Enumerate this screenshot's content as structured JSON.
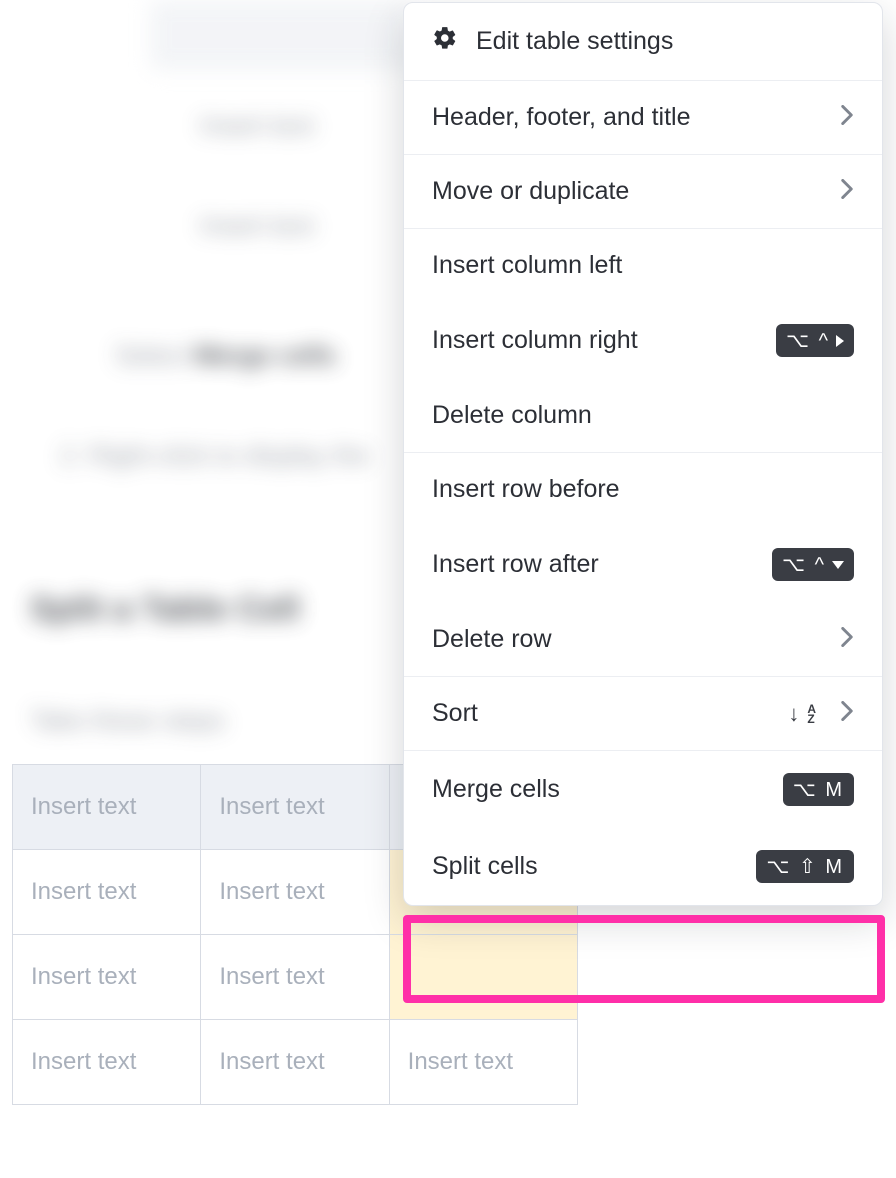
{
  "menu": {
    "edit_settings": "Edit table settings",
    "header_footer_title": "Header, footer, and title",
    "move_duplicate": "Move or duplicate",
    "insert_col_left": "Insert column left",
    "insert_col_right": "Insert column right",
    "insert_col_right_kbd": "⌥ ^",
    "delete_column": "Delete column",
    "insert_row_before": "Insert row before",
    "insert_row_after": "Insert row after",
    "insert_row_after_kbd": "⌥ ^",
    "delete_row": "Delete row",
    "sort": "Sort",
    "merge_cells": "Merge cells",
    "merge_cells_kbd": "⌥  M",
    "split_cells": "Split cells",
    "split_cells_kbd": "⌥ ⇧  M"
  },
  "table": {
    "placeholder": "Insert text"
  }
}
